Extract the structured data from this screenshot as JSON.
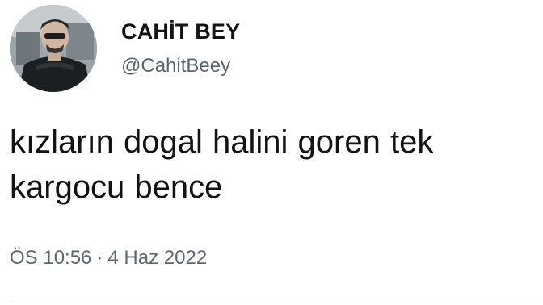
{
  "tweet": {
    "display_name": "CAHİT BEY",
    "username": "@CahitBeey",
    "text_line1": "kızların dogal halini goren tek",
    "text_line2": "kargocu bence",
    "time": "ÖS 10:56",
    "separator": "·",
    "date": "4 Haz 2022"
  },
  "icons": {
    "avatar": "profile-photo"
  },
  "colors": {
    "background": "#ffffff",
    "text_primary": "#111315",
    "text_secondary": "#5b6570"
  }
}
